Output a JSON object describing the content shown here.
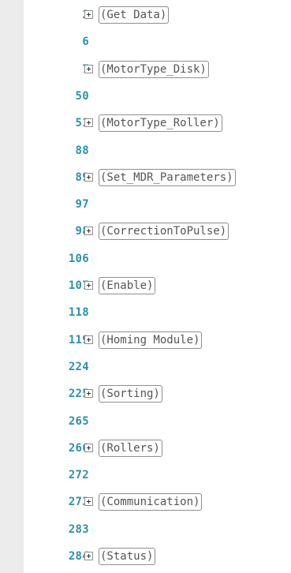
{
  "lines": [
    {
      "number": "3",
      "region": "(Get Data)"
    },
    {
      "number": "6",
      "region": null
    },
    {
      "number": "7",
      "region": "(MotorType_Disk)"
    },
    {
      "number": "50",
      "region": null
    },
    {
      "number": "51",
      "region": "(MotorType_Roller)"
    },
    {
      "number": "88",
      "region": null
    },
    {
      "number": "89",
      "region": "(Set_MDR_Parameters)"
    },
    {
      "number": "97",
      "region": null
    },
    {
      "number": "98",
      "region": "(CorrectionToPulse)"
    },
    {
      "number": "106",
      "region": null
    },
    {
      "number": "107",
      "region": "(Enable)"
    },
    {
      "number": "118",
      "region": null
    },
    {
      "number": "119",
      "region": "(Homing Module)"
    },
    {
      "number": "224",
      "region": null
    },
    {
      "number": "225",
      "region": "(Sorting)"
    },
    {
      "number": "265",
      "region": null
    },
    {
      "number": "266",
      "region": "(Rollers)"
    },
    {
      "number": "272",
      "region": null
    },
    {
      "number": "273",
      "region": "(Communication)"
    },
    {
      "number": "283",
      "region": null
    },
    {
      "number": "284",
      "region": "(Status)"
    }
  ],
  "icons": {
    "fold_toggle": "expand-plus-box-icon"
  },
  "colors": {
    "line_number": "#2b91af",
    "region_text": "#555555",
    "region_border": "#8e8e8e",
    "margin": "#ececec",
    "background": "#ffffff"
  }
}
